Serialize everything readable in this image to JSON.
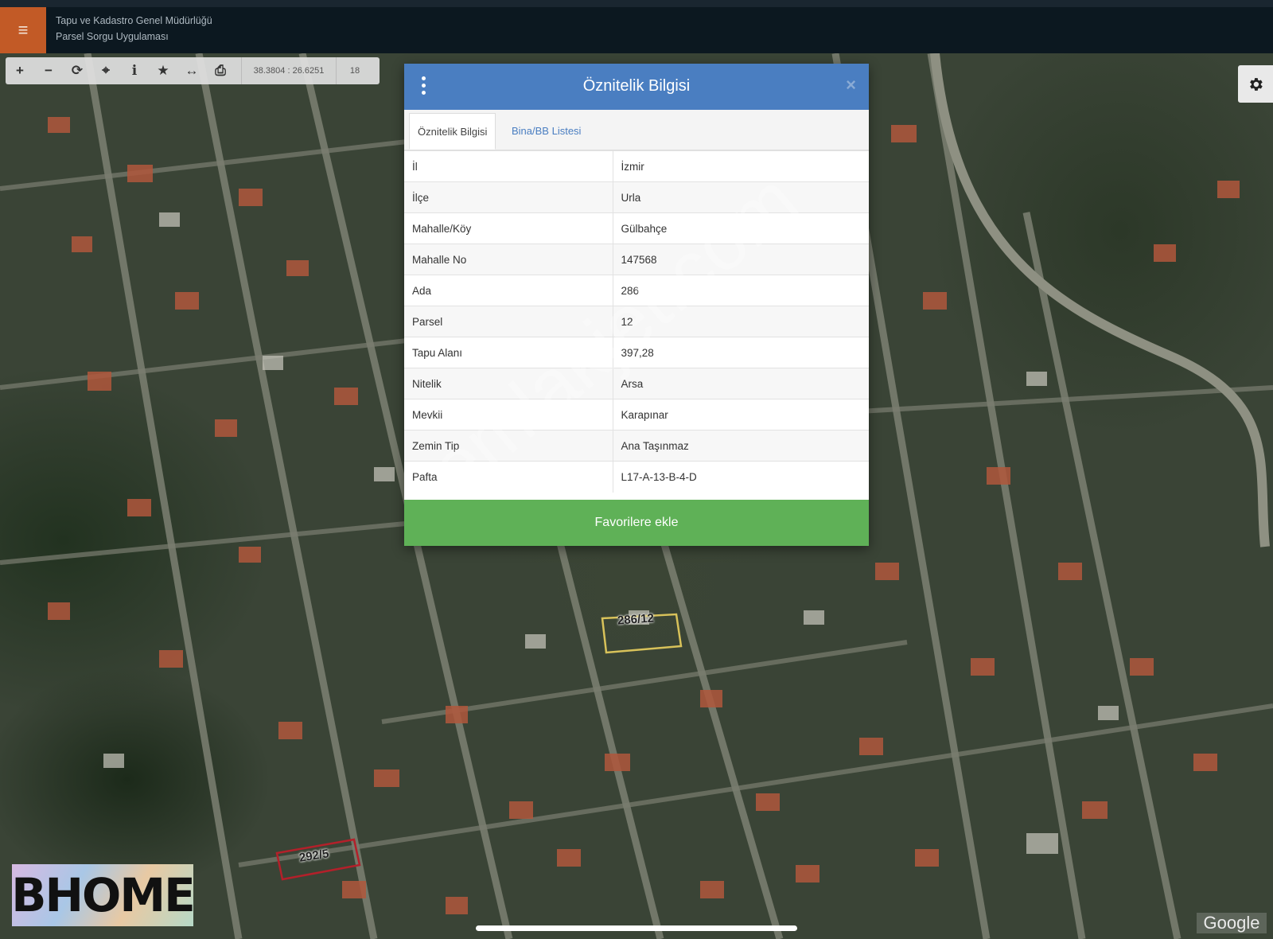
{
  "header": {
    "menu_icon": "hamburger-icon",
    "title_line1": "Tapu ve Kadastro Genel Müdürlüğü",
    "title_line2": "Parsel Sorgu Uygulaması"
  },
  "toolbar": {
    "tools": [
      "zoom-in-icon",
      "zoom-out-icon",
      "refresh-icon",
      "locate-icon",
      "info-icon",
      "star-icon",
      "measure-icon",
      "print-icon"
    ],
    "coordinates": "38.3804 : 26.6251",
    "zoom_level": "18"
  },
  "dialog": {
    "title": "Öznitelik Bilgisi",
    "close_symbol": "×",
    "tabs": [
      {
        "label": "Öznitelik Bilgisi",
        "active": true
      },
      {
        "label": "Bina/BB Listesi",
        "active": false
      }
    ],
    "rows": [
      {
        "key": "İl",
        "value": "İzmir"
      },
      {
        "key": "İlçe",
        "value": "Urla"
      },
      {
        "key": "Mahalle/Köy",
        "value": "Gülbahçe"
      },
      {
        "key": "Mahalle No",
        "value": "147568"
      },
      {
        "key": "Ada",
        "value": "286"
      },
      {
        "key": "Parsel",
        "value": "12"
      },
      {
        "key": "Tapu Alanı",
        "value": "397,28"
      },
      {
        "key": "Nitelik",
        "value": "Arsa"
      },
      {
        "key": "Mevkii",
        "value": "Karapınar"
      },
      {
        "key": "Zemin Tip",
        "value": "Ana Taşınmaz"
      },
      {
        "key": "Pafta",
        "value": "L17-A-13-B-4-D"
      }
    ],
    "favorite_button": "Favorilere ekle"
  },
  "map": {
    "parcel_main_label": "286/12",
    "parcel_other_label": "292/5",
    "highlight_color": "#d8c25a",
    "other_parcel_color": "#b3202a"
  },
  "overlays": {
    "watermark": "emlakjet.com",
    "brand_logo": "BHOME",
    "map_attribution": "Google"
  }
}
